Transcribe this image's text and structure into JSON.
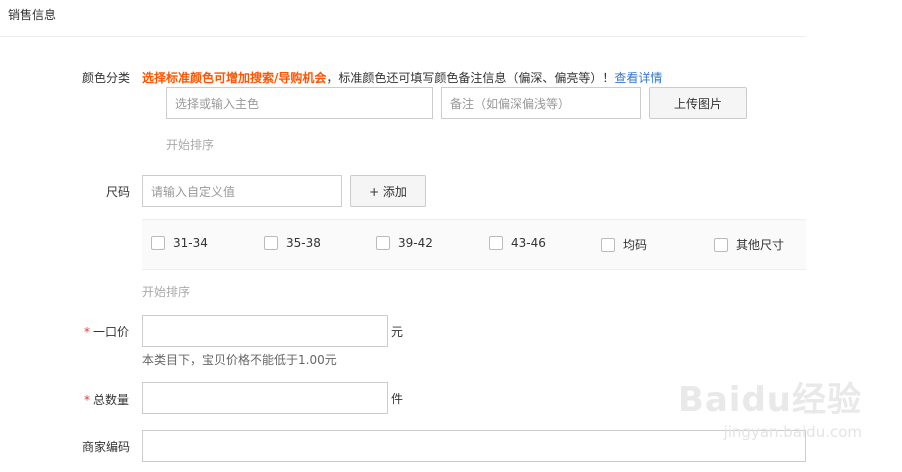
{
  "section": {
    "title": "销售信息"
  },
  "color_category": {
    "label": "颜色分类",
    "tip_strong": "选择标准颜色可增加搜索/导购机会",
    "tip_text": "，标准颜色还可填写颜色备注信息（偏深、偏亮等）！",
    "tip_link": "查看详情",
    "main_color_placeholder": "选择或输入主色",
    "note_placeholder": "备注（如偏深偏浅等）",
    "upload_button": "上传图片",
    "sort_label": "开始排序"
  },
  "size": {
    "label": "尺码",
    "custom_placeholder": "请输入自定义值",
    "add_button": "+ 添加",
    "options": [
      "31-34",
      "35-38",
      "39-42",
      "43-46",
      "均码",
      "其他尺寸"
    ],
    "sort_label": "开始排序"
  },
  "price": {
    "required_mark": "*",
    "label": "一口价",
    "unit": "元",
    "hint": "本类目下，宝贝价格不能低于1.00元"
  },
  "quantity": {
    "required_mark": "*",
    "label": "总数量",
    "unit": "件"
  },
  "merchant_code": {
    "label": "商家编码"
  },
  "watermark": {
    "logo": "Baidu经验",
    "url": "jingyan.baidu.com"
  }
}
